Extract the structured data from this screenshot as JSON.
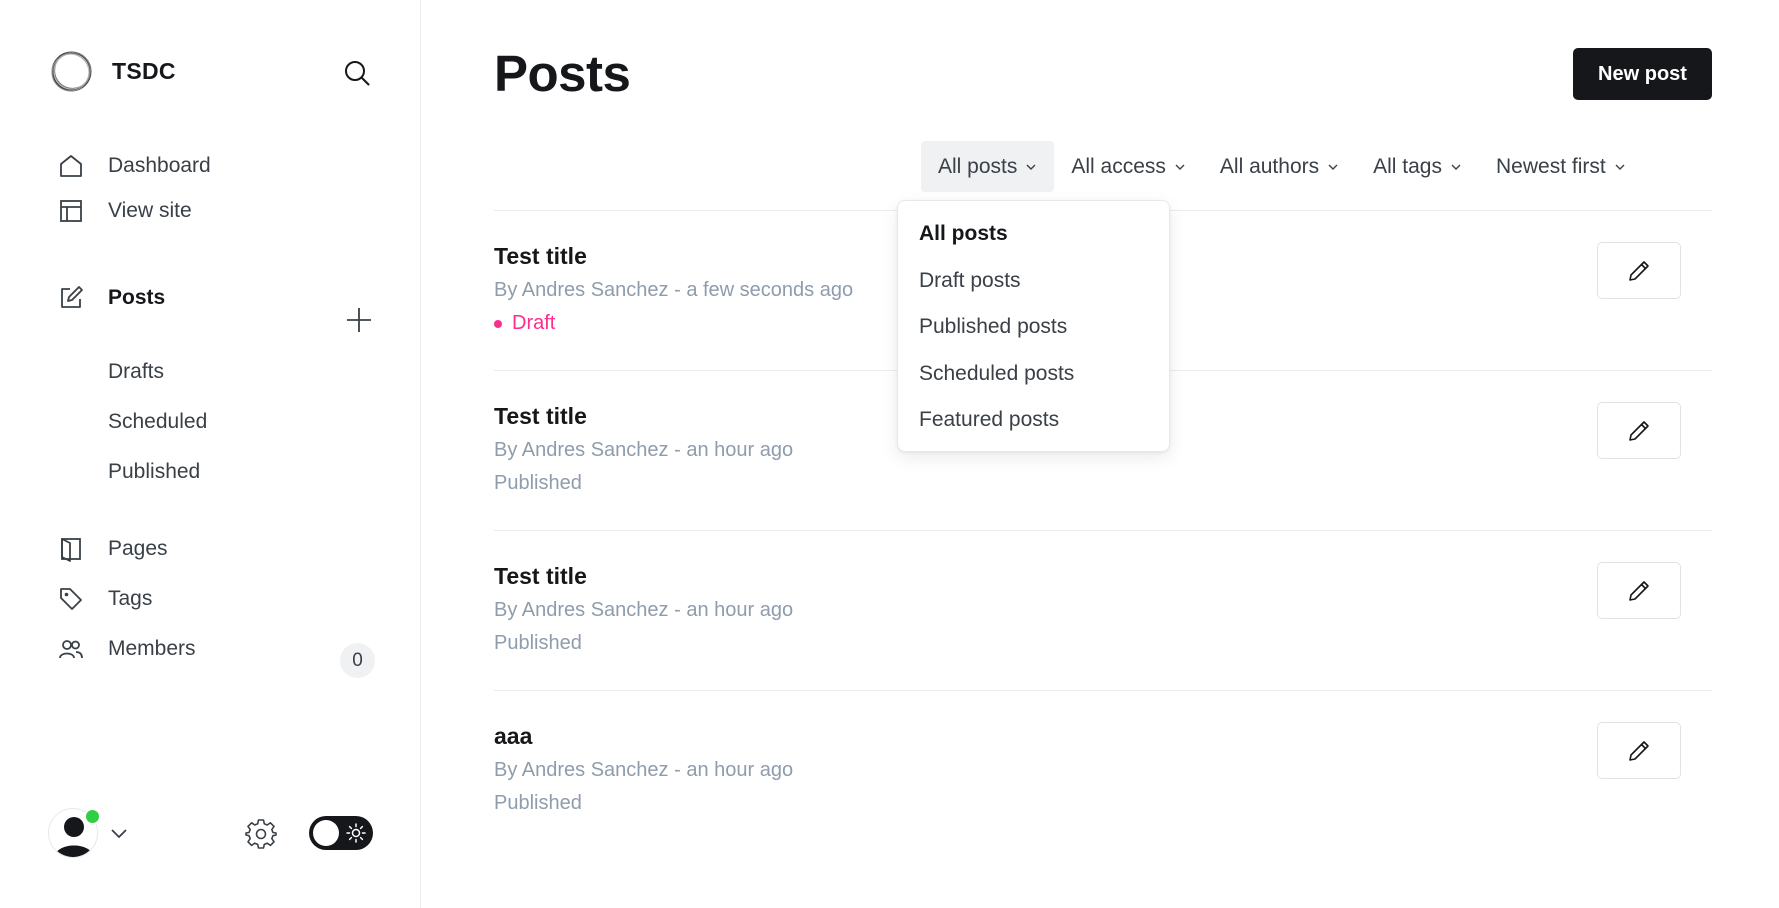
{
  "brand": {
    "name": "TSDC"
  },
  "sidebar": {
    "primary": [
      {
        "label": "Dashboard",
        "icon": "home-icon"
      },
      {
        "label": "View site",
        "icon": "layout-icon"
      }
    ],
    "posts": {
      "label": "Posts",
      "icon": "edit-icon"
    },
    "post_sub": [
      {
        "label": "Drafts"
      },
      {
        "label": "Scheduled"
      },
      {
        "label": "Published"
      }
    ],
    "secondary": [
      {
        "label": "Pages",
        "icon": "page-icon"
      },
      {
        "label": "Tags",
        "icon": "tag-icon"
      },
      {
        "label": "Members",
        "icon": "members-icon",
        "count": "0"
      }
    ]
  },
  "main": {
    "title": "Posts",
    "new_post_label": "New post",
    "filters": [
      {
        "label": "All posts",
        "open": true
      },
      {
        "label": "All access"
      },
      {
        "label": "All authors"
      },
      {
        "label": "All tags"
      },
      {
        "label": "Newest first"
      }
    ],
    "dropdown": {
      "options": [
        "All posts",
        "Draft posts",
        "Published posts",
        "Scheduled posts",
        "Featured posts"
      ],
      "selected": "All posts"
    },
    "posts": [
      {
        "title": "Test title",
        "meta": "By Andres Sanchez - a few seconds ago",
        "status": "Draft"
      },
      {
        "title": "Test title",
        "meta": "By Andres Sanchez - an hour ago",
        "status": "Published"
      },
      {
        "title": "Test title",
        "meta": "By Andres Sanchez - an hour ago",
        "status": "Published"
      },
      {
        "title": "aaa",
        "meta": "By Andres Sanchez - an hour ago",
        "status": "Published"
      }
    ]
  },
  "colors": {
    "accent_draft": "#fb2d8d",
    "online": "#30cf43",
    "primary_button": "#15171a"
  }
}
